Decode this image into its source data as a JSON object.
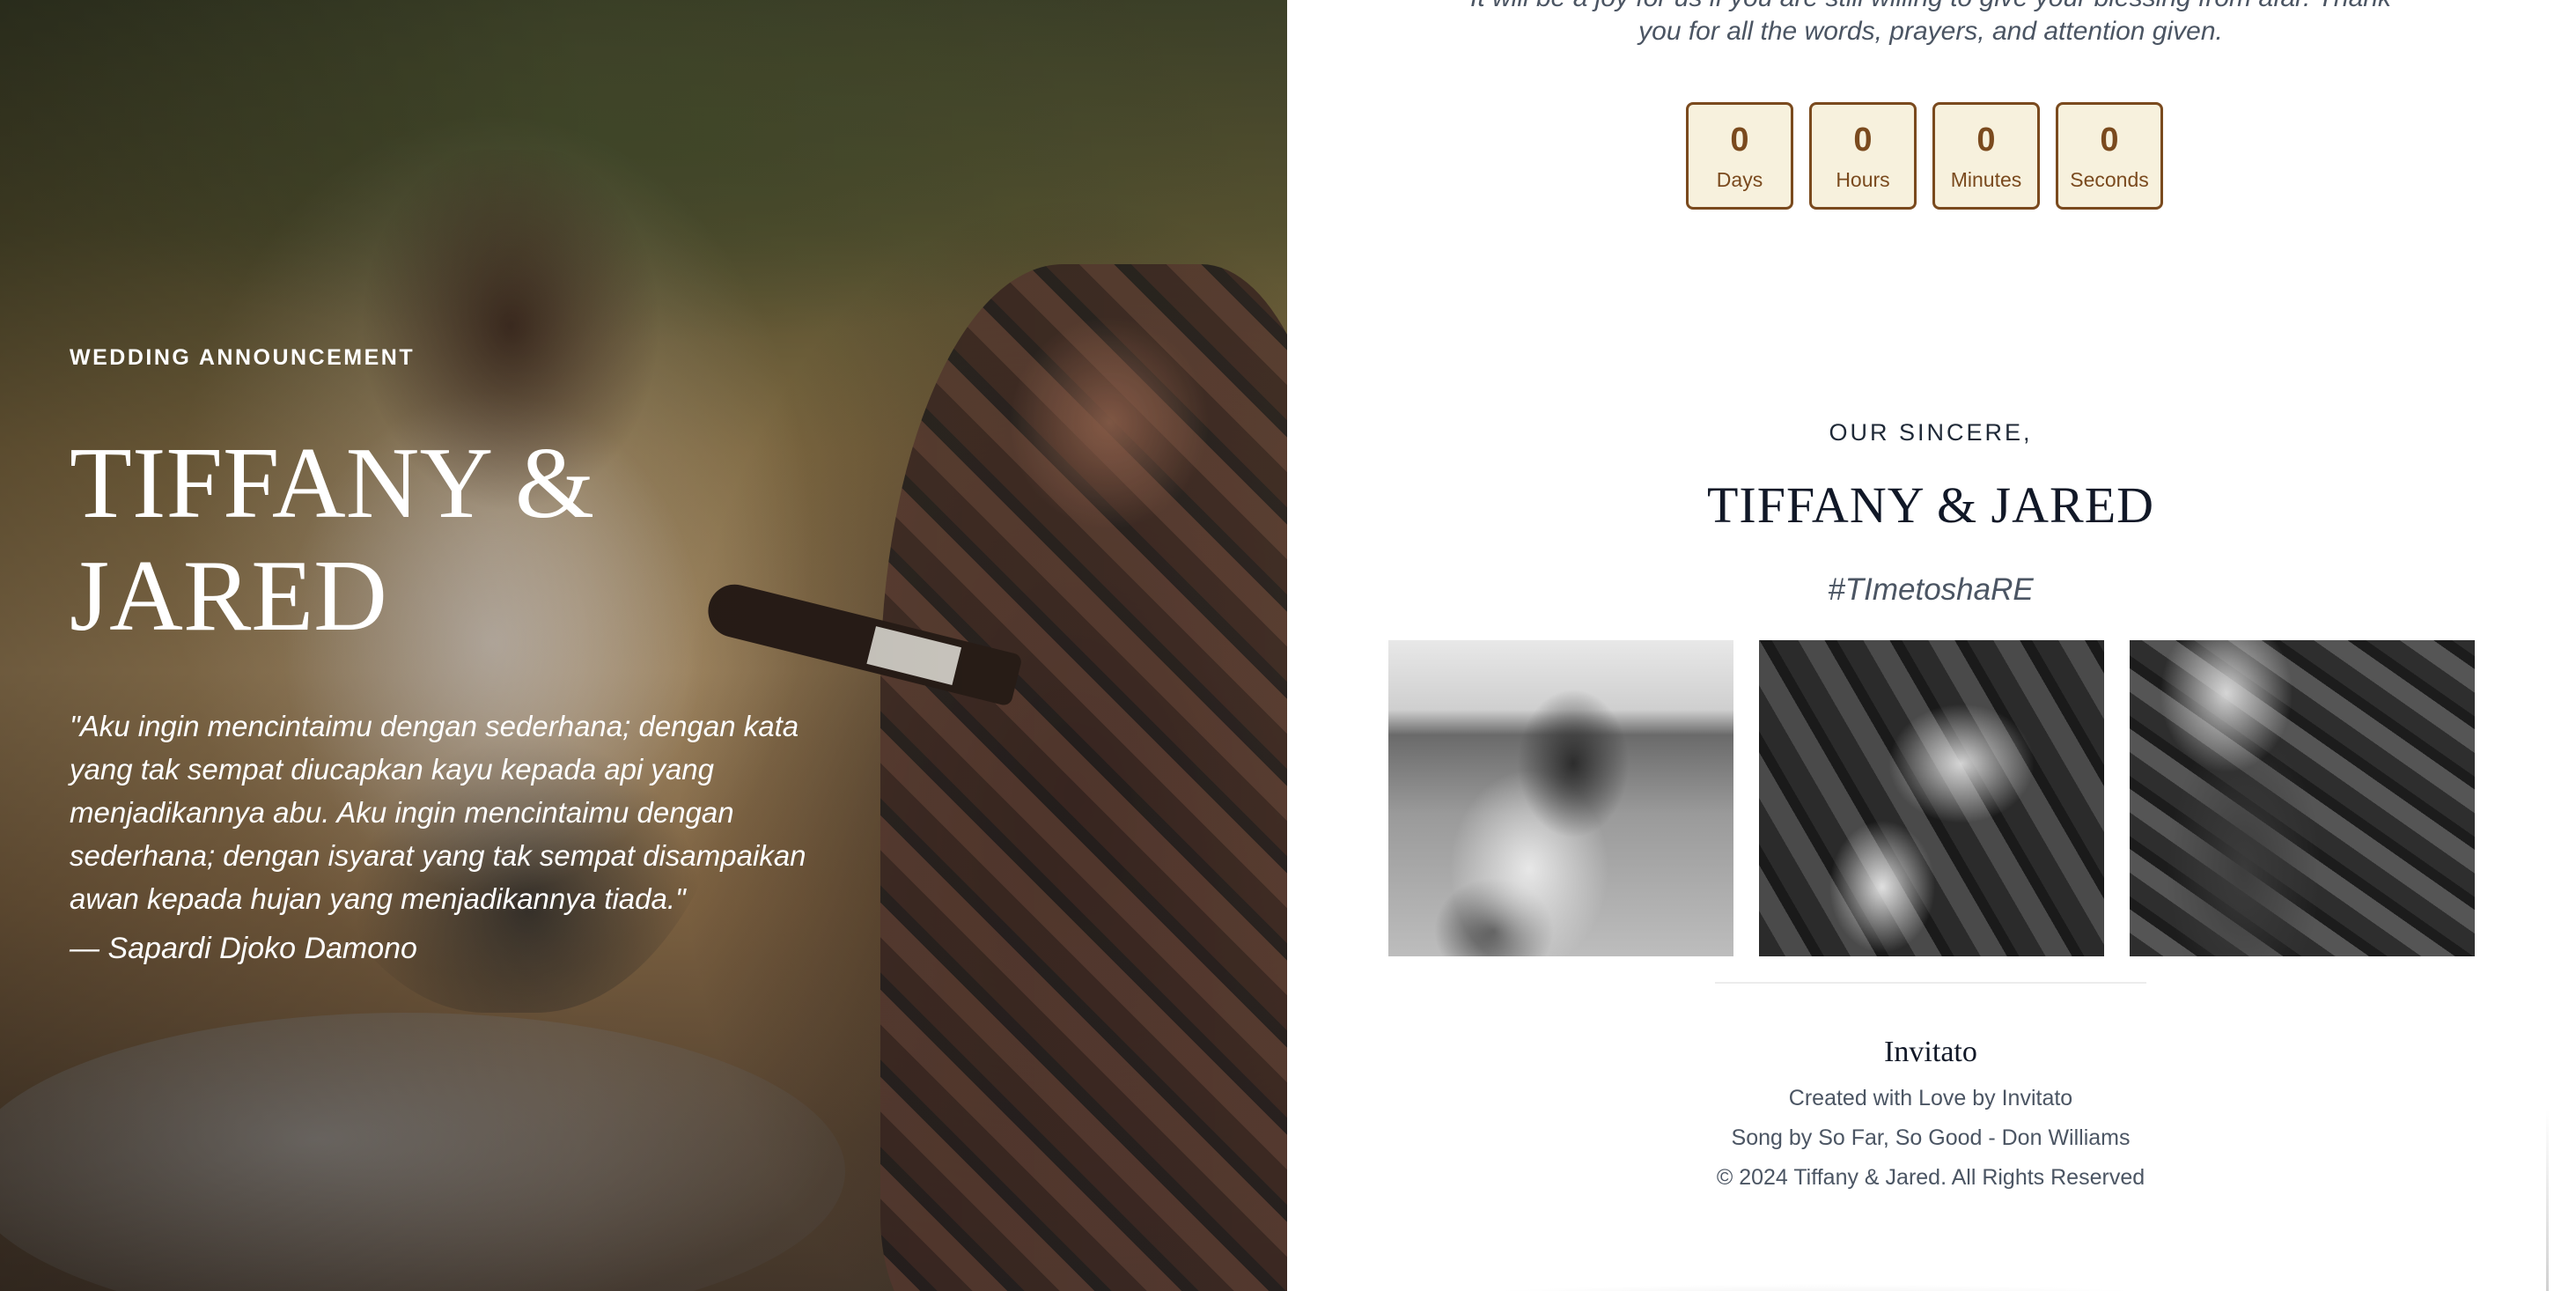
{
  "hero": {
    "eyebrow": "WEDDING ANNOUNCEMENT",
    "title_line1": "TIFFANY &",
    "title_line2": "JARED",
    "quote": "\"Aku ingin mencintaimu dengan sederhana; dengan kata yang tak sempat diucapkan kayu kepada api yang menjadikannya abu. Aku ingin mencintaimu dengan sederhana; dengan isyarat yang tak sempat disampaikan awan kepada hujan yang menjadikannya tiada.\"",
    "quote_author": "— Sapardi Djoko Damono"
  },
  "message": {
    "line1": "It will be a joy for us if you are still willing to give your blessing from afar. Thank",
    "line2": "you for all the words, prayers, and attention given."
  },
  "countdown": [
    {
      "value": "0",
      "label": "Days"
    },
    {
      "value": "0",
      "label": "Hours"
    },
    {
      "value": "0",
      "label": "Minutes"
    },
    {
      "value": "0",
      "label": "Seconds"
    }
  ],
  "closing": {
    "sincere": "OUR SINCERE,",
    "names": "TIFFANY & JARED",
    "hashtag": "#TImetoshaRE"
  },
  "footer": {
    "brand": "Invitato",
    "credit": "Created with Love by Invitato",
    "song": "Song by So Far, So Good - Don Williams",
    "copyright": "© 2024 Tiffany & Jared. All Rights Reserved"
  },
  "colors": {
    "accent": "#7a4a1e",
    "countdown_bg": "#f7f1dd",
    "muted_text": "#4b5563"
  }
}
